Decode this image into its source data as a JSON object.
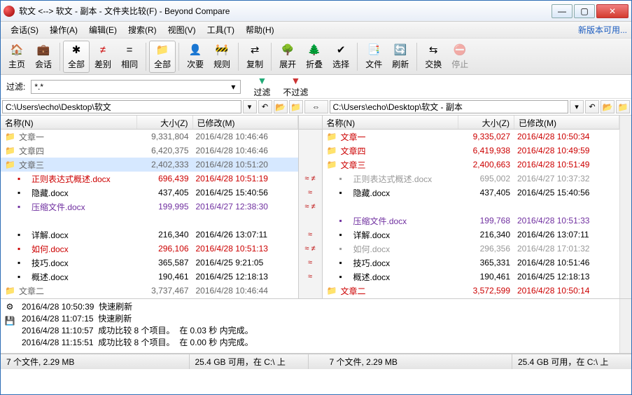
{
  "window": {
    "title": "软文 <--> 软文 - 副本 - 文件夹比较(F) - Beyond Compare"
  },
  "menu": {
    "items": [
      "会话(S)",
      "操作(A)",
      "编辑(E)",
      "搜索(R)",
      "视图(V)",
      "工具(T)",
      "帮助(H)"
    ],
    "updateLink": "新版本可用..."
  },
  "toolbar": {
    "home": "主页",
    "sessions": "会话",
    "all": "全部",
    "diff": "差别",
    "same": "相同",
    "structAll": "全部",
    "minor": "次要",
    "rules": "规则",
    "copy": "复制",
    "expand": "展开",
    "collapse": "折叠",
    "select": "选择",
    "files": "文件",
    "refresh": "刷新",
    "swap": "交换",
    "stop": "停止"
  },
  "filter": {
    "label": "过滤:",
    "value": "*.*",
    "filterBtn": "过滤",
    "noFilterBtn": "不过滤"
  },
  "paths": {
    "left": "C:\\Users\\echo\\Desktop\\软文",
    "right": "C:\\Users\\echo\\Desktop\\软文 - 副本"
  },
  "headers": {
    "name": "名称(N)",
    "size": "大小(Z)",
    "modified": "已修改(M)"
  },
  "left": [
    {
      "t": "folder",
      "n": "文章一",
      "s": "9,331,804",
      "d": "2016/4/28 10:46:46"
    },
    {
      "t": "folder",
      "n": "文章四",
      "s": "6,420,375",
      "d": "2016/4/28 10:46:46"
    },
    {
      "t": "folder",
      "n": "文章三",
      "s": "2,402,333",
      "d": "2016/4/28 10:51:20",
      "sel": true
    },
    {
      "t": "file",
      "n": "正则表达式概述.docx",
      "s": "696,439",
      "d": "2016/4/28 10:51:19",
      "c": "red",
      "i": 1
    },
    {
      "t": "file",
      "n": "隐藏.docx",
      "s": "437,405",
      "d": "2016/4/25 15:40:56",
      "i": 1
    },
    {
      "t": "file",
      "n": "压缩文件.docx",
      "s": "199,995",
      "d": "2016/4/27 12:38:30",
      "c": "purple",
      "i": 1
    },
    {
      "t": "blank"
    },
    {
      "t": "file",
      "n": "详解.docx",
      "s": "216,340",
      "d": "2016/4/26 13:07:11",
      "i": 1
    },
    {
      "t": "file",
      "n": "如何.docx",
      "s": "296,106",
      "d": "2016/4/28 10:51:13",
      "c": "red",
      "i": 1
    },
    {
      "t": "file",
      "n": "技巧.docx",
      "s": "365,587",
      "d": "2016/4/25 9:21:05",
      "i": 1
    },
    {
      "t": "file",
      "n": "概述.docx",
      "s": "190,461",
      "d": "2016/4/25 12:18:13",
      "i": 1
    },
    {
      "t": "folder",
      "n": "文章二",
      "s": "3,737,467",
      "d": "2016/4/28 10:46:44"
    }
  ],
  "right": [
    {
      "t": "folder",
      "n": "文章一",
      "s": "9,335,027",
      "d": "2016/4/28 10:50:34",
      "c": "red"
    },
    {
      "t": "folder",
      "n": "文章四",
      "s": "6,419,938",
      "d": "2016/4/28 10:49:59",
      "c": "red"
    },
    {
      "t": "folder",
      "n": "文章三",
      "s": "2,400,663",
      "d": "2016/4/28 10:51:49",
      "c": "red"
    },
    {
      "t": "file",
      "n": "正则表达式概述.docx",
      "s": "695,002",
      "d": "2016/4/27 10:37:32",
      "i": 1,
      "g": true
    },
    {
      "t": "file",
      "n": "隐藏.docx",
      "s": "437,405",
      "d": "2016/4/25 15:40:56",
      "i": 1
    },
    {
      "t": "blank"
    },
    {
      "t": "file",
      "n": "压缩文件.docx",
      "s": "199,768",
      "d": "2016/4/28 10:51:33",
      "c": "purple",
      "i": 1
    },
    {
      "t": "file",
      "n": "详解.docx",
      "s": "216,340",
      "d": "2016/4/26 13:07:11",
      "i": 1
    },
    {
      "t": "file",
      "n": "如何.docx",
      "s": "296,356",
      "d": "2016/4/28 17:01:32",
      "i": 1,
      "g": true
    },
    {
      "t": "file",
      "n": "技巧.docx",
      "s": "365,331",
      "d": "2016/4/28 10:51:46",
      "i": 1
    },
    {
      "t": "file",
      "n": "概述.docx",
      "s": "190,461",
      "d": "2016/4/25 12:18:13",
      "i": 1
    },
    {
      "t": "folder",
      "n": "文章二",
      "s": "3,572,599",
      "d": "2016/4/28 10:50:14",
      "c": "red"
    }
  ],
  "mid": [
    "",
    "",
    "",
    "≈ ≠",
    "≈",
    "≈ ≠",
    "",
    "≈",
    "≈ ≠",
    "≈",
    "≈",
    ""
  ],
  "log": [
    "2016/4/28 10:50:39  快速刷新",
    "2016/4/28 11:07:15  快速刷新",
    "2016/4/28 11:10:57  成功比较 8 个项目。  在 0.03 秒 内完成。",
    "2016/4/28 11:15:51  成功比较 8 个项目。  在 0.00 秒 内完成。"
  ],
  "status": {
    "leftCount": "7 个文件, 2.29 MB",
    "leftFree": "25.4 GB 可用，在 C:\\ 上",
    "rightCount": "7 个文件, 2.29 MB",
    "rightFree": "25.4 GB 可用，在 C:\\ 上"
  }
}
